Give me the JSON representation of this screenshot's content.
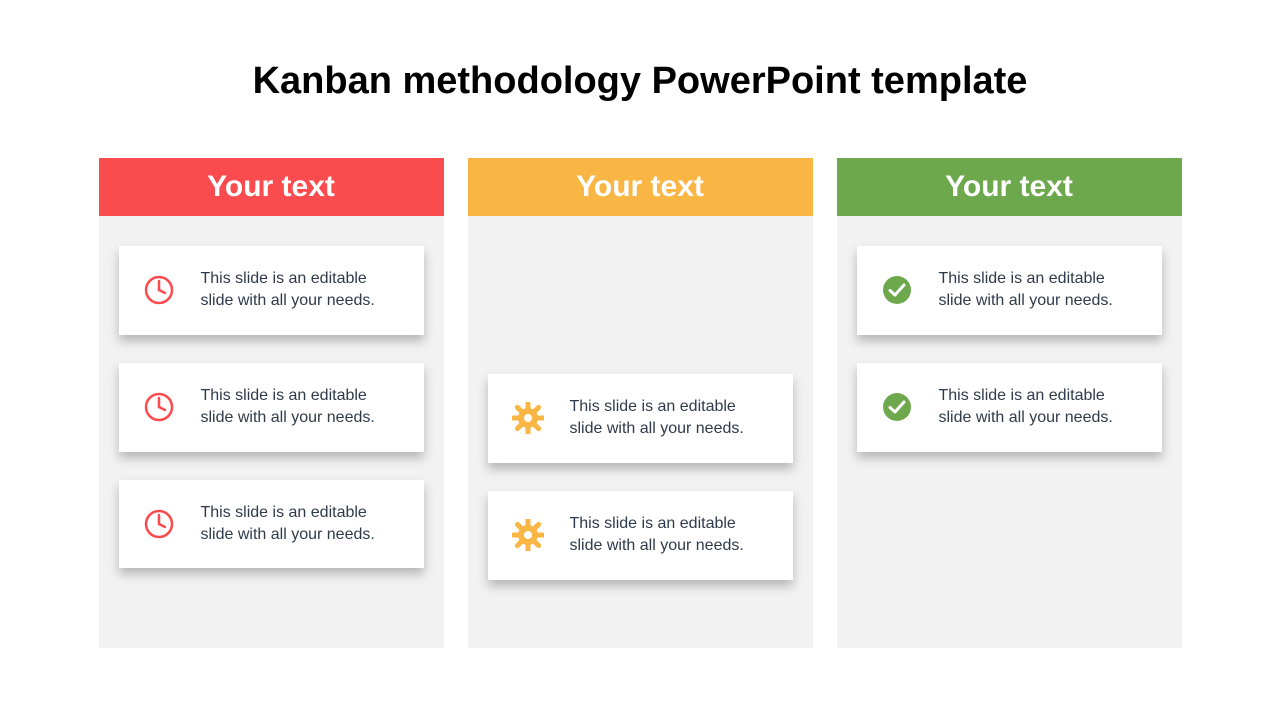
{
  "title": "Kanban methodology PowerPoint template",
  "colors": {
    "red": "#fa4b4e",
    "amber": "#fab644",
    "green": "#6ea84c"
  },
  "columns": [
    {
      "header": "Your text",
      "color_key": "red",
      "icon": "clock",
      "top_spacer": false,
      "cards": [
        {
          "text": "This slide is an editable slide with all your needs."
        },
        {
          "text": "This slide is an editable slide with all your needs."
        },
        {
          "text": "This slide is an editable slide with all your needs."
        }
      ]
    },
    {
      "header": "Your text",
      "color_key": "amber",
      "icon": "gear",
      "top_spacer": true,
      "cards": [
        {
          "text": "This slide is an editable slide with all your needs."
        },
        {
          "text": "This slide is an editable slide with all your needs."
        }
      ]
    },
    {
      "header": "Your text",
      "color_key": "green",
      "icon": "check",
      "top_spacer": false,
      "cards": [
        {
          "text": "This slide is an editable slide with all your needs."
        },
        {
          "text": "This slide is an editable slide with all your needs."
        }
      ]
    }
  ]
}
